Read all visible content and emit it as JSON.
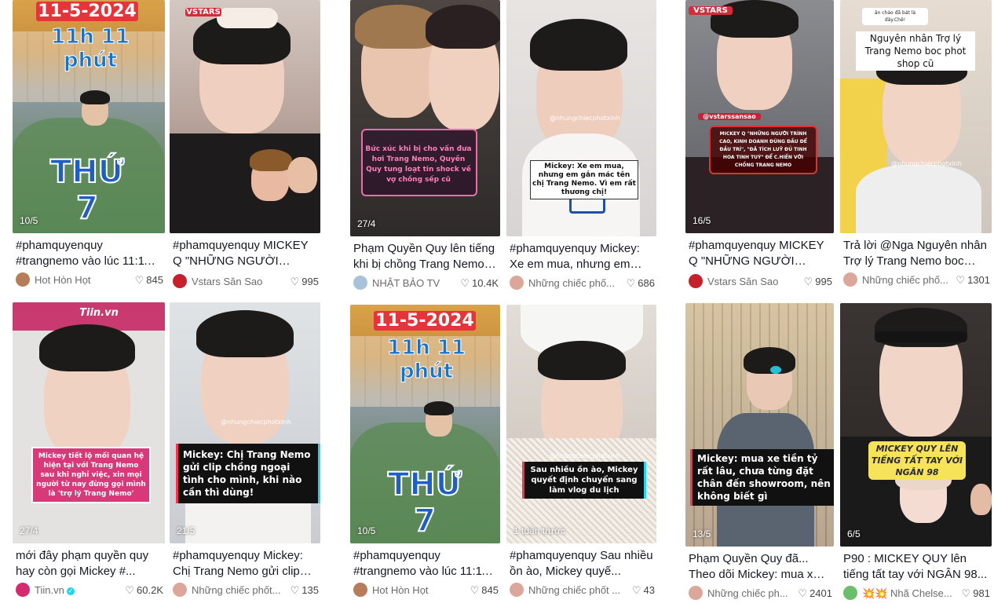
{
  "videos": [
    {
      "caption": "#phamquyenquy #trangnemo vào lúc 11:11 ...",
      "author": "Hot Hòn Họt",
      "likes": "845",
      "date": "10/5",
      "overlay": {
        "top1": "11-5-2024",
        "top2": "11h 11 phút",
        "big": "THỨ 7"
      }
    },
    {
      "caption": "#phamquyenquy MICKEY Q \"NHỮNG NGƯỜI TRÌNH...",
      "author": "Vstars Săn Sao",
      "likes": "995",
      "date": "",
      "overlay": {
        "brand": "VSTARS"
      }
    },
    {
      "caption": "Phạm Quyền Quy lên tiếng khi bị chồng Trang Nemo ...",
      "author": "NHẬT BẢO TV",
      "likes": "10.4K",
      "date": "27/4",
      "overlay": {
        "text": "Bức xúc khi bị cho vấn đưa hơi Trang Nemo, Quyền Quy tung loạt tin shock về vợ chồng sếp cũ"
      }
    },
    {
      "caption": "#phamquyenquy Mickey: Xe em mua, nhưng em gắ...",
      "author": "Những chiếc phố...",
      "likes": "686",
      "date": "",
      "overlay": {
        "handle": "@nhungchiecphotxinh",
        "text": "Mickey: Xe em mua, nhưng em gắn mác tên chị Trang Nemo. Vì em rất thương chị!"
      }
    },
    {
      "caption": "#phamquyenquy MICKEY Q \"NHỮNG NGƯỜI TRÌNH...",
      "author": "Vstars Săn Sao",
      "likes": "995",
      "date": "16/5",
      "overlay": {
        "brand": "VSTARS",
        "handle": "@vstarssansao",
        "text": "MICKEY Q \"NHỮNG NGƯỜI TRÌNH CAO, KINH DOANH ĐÚNG ĐẦU ĐỂ ĐẦU TRÍ\", \"ĐÃ TÍCH LUỸ ĐỦ TINH HOA TINH TUÝ\" ĐỂ C.HIẾN VỚI CHỒNG TRANG NEMO"
      }
    },
    {
      "caption": "Trả lời @Nga Nguyên nhân Trợ lý Trang Nemo boc ph...",
      "author": "Những chiếc phố...",
      "likes": "1301",
      "date": "",
      "overlay": {
        "reply": "ăn chảo đã bát là đây.Chê!",
        "text": "Nguyên nhân Trợ lý Trang Nemo boc phot shop cũ",
        "handle": "@nhungchiecphotxinh"
      }
    },
    {
      "caption": "mới đây phạm quyền quy hay còn gọi Mickey #...",
      "author": "Tiin.vn",
      "likes": "60.2K",
      "date": "27/4",
      "overlay": {
        "logo": "Tiin.vn",
        "text": "Mickey tiết lộ mối quan hệ hiện tại với Trang Nemo sau khi nghỉ việc, xin mọi người từ nay đừng gọi mình là 'trợ lý Trang Nemo'"
      }
    },
    {
      "caption": "#phamquyenquy Mickey: Chị Trang Nemo gửi clip c...",
      "author": "Những chiếc phốt...",
      "likes": "135",
      "date": "21/5",
      "overlay": {
        "handle": "@nhungchiecphotxinh",
        "text": "Mickey: Chị Trang Nemo gửi clip chồng ngoại tình cho mình, khi nào cần thì dùng!"
      }
    },
    {
      "caption": "#phamquyenquy #trangnemo vào lúc 11:11 ...",
      "author": "Hot Hòn Họt",
      "likes": "845",
      "date": "10/5",
      "overlay": {
        "top1": "11-5-2024",
        "top2": "11h 11 phút",
        "big": "THỨ 7"
      }
    },
    {
      "caption": "#phamquyenquy Sau nhiều ồn ào, Mickey quyế...",
      "author": "Những chiếc phốt ...",
      "likes": "43",
      "date": "1 tuần trước",
      "overlay": {
        "handle": "@nhungchiecphotxinh",
        "text": "Sau nhiều ồn ào, Mickey quyết định chuyển sang làm vlog du lịch"
      }
    },
    {
      "caption": "Phạm Quyền Quy đã... Theo dõi Mickey: mua xe ...",
      "author": "Những chiếc ph...",
      "likes": "2401",
      "date": "13/5",
      "overlay": {
        "text": "Mickey: mua xe tiền tỷ rất lâu, chưa từng đặt chân đến showroom, nên không biết gì"
      }
    },
    {
      "caption": "P90 : MICKEY QUY lên tiếng tất tay với NGÂN 98...",
      "author": "💥💥 Nhã Chelse...",
      "likes": "981",
      "date": "6/5",
      "overlay": {
        "text": "MICKEY QUY LÊN TIẾNG TẤT TAY VỚI NGÂN 98"
      }
    }
  ]
}
